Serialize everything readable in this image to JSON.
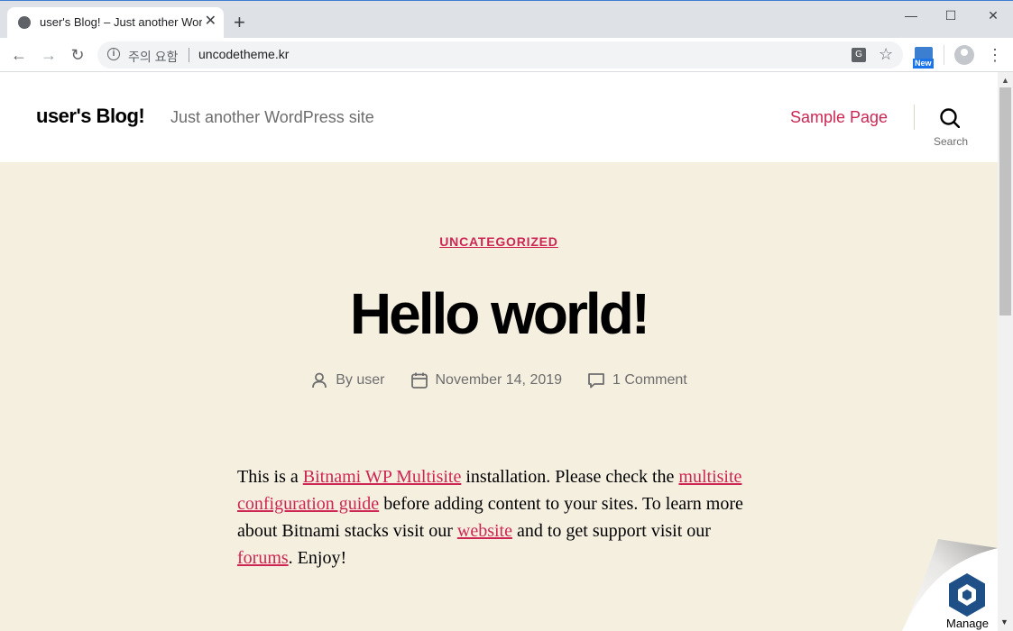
{
  "browser": {
    "tab_title": "user's Blog! – Just another WordPress site",
    "tab_close": "✕",
    "new_tab": "+",
    "window_controls": {
      "minimize": "—",
      "maximize": "☐",
      "close": "✕"
    },
    "security_label": "주의 요함",
    "url": "uncodetheme.kr",
    "extension_badge": "New"
  },
  "site": {
    "title": "user's Blog!",
    "description": "Just another WordPress site",
    "menu_item": "Sample Page",
    "search_label": "Search"
  },
  "post": {
    "category": "UNCATEGORIZED",
    "title": "Hello world!",
    "author": "By user",
    "date": "November 14, 2019",
    "comments": "1 Comment",
    "body": {
      "t1": "This is a ",
      "link1": "Bitnami WP Multisite",
      "t2": " installation. Please check the ",
      "link2": "multisite configuration guide",
      "t3": " before adding content to your sites. To learn more about Bitnami stacks visit our ",
      "link3": "website",
      "t4": " and to get support visit our ",
      "link4": "forums",
      "t5": ". Enjoy!"
    }
  },
  "manage": {
    "label": "Manage",
    "arrow": "▼"
  },
  "colors": {
    "accent": "#cd2653",
    "content_bg": "#f5efe0",
    "bitnami_blue": "#1f4f87"
  }
}
